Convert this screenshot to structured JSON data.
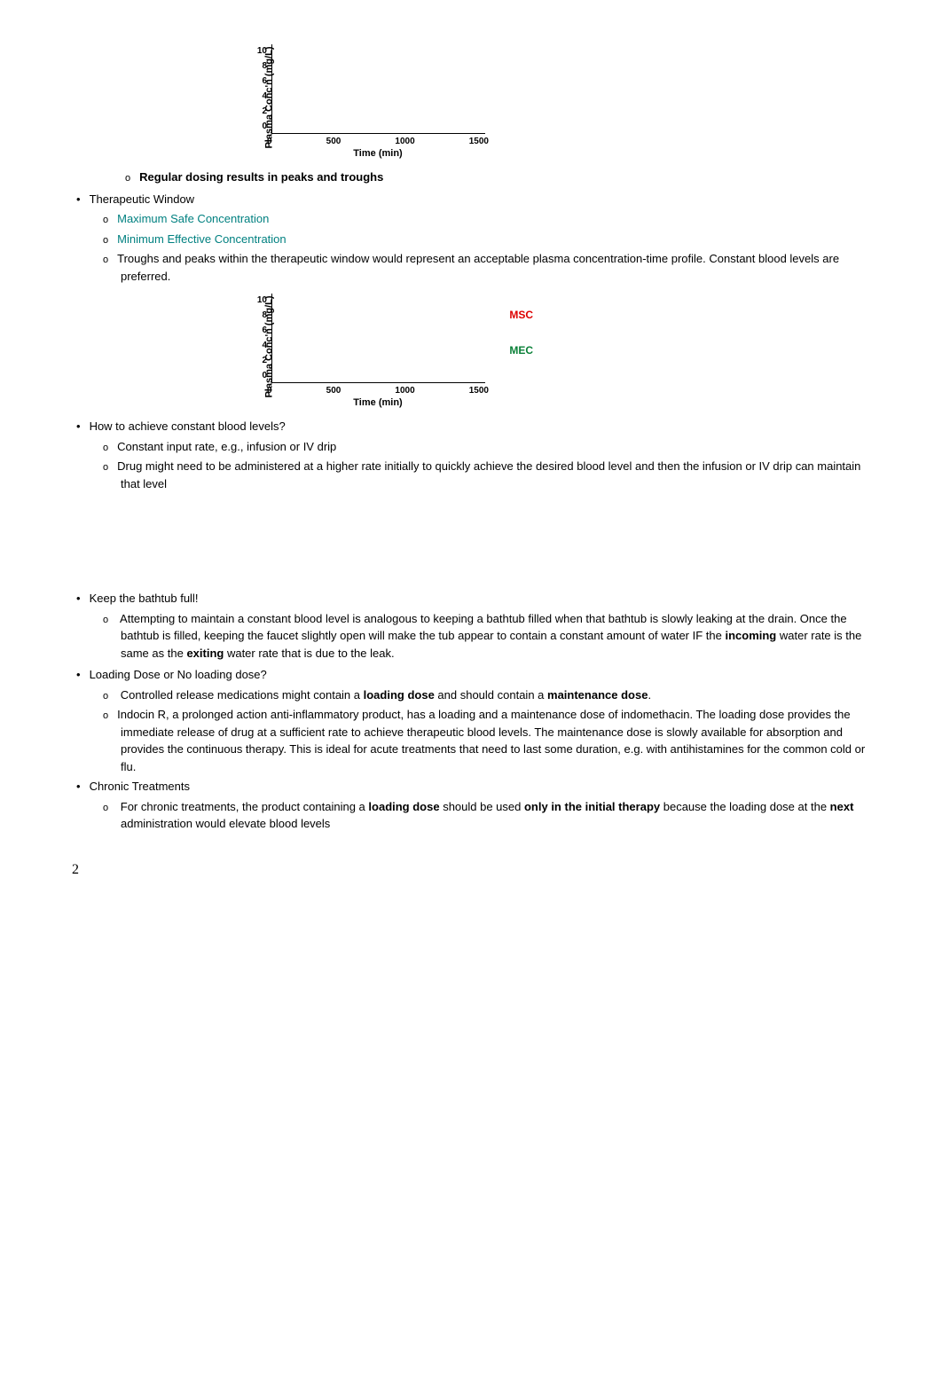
{
  "chart_data": [
    {
      "type": "line",
      "title": "",
      "xlabel": "Time (min)",
      "ylabel": "Plasma Conc'n (mg/L)",
      "x_ticks": [
        "0",
        "500",
        "1000",
        "1500"
      ],
      "y_ticks": [
        "10",
        "8",
        "6",
        "4",
        "2",
        "0"
      ],
      "xlim": [
        0,
        1500
      ],
      "ylim": [
        0,
        10
      ],
      "series": []
    },
    {
      "type": "line",
      "title": "",
      "xlabel": "Time (min)",
      "ylabel": "Plasma Conc'n (mg/L)",
      "x_ticks": [
        "0",
        "500",
        "1000",
        "1500"
      ],
      "y_ticks": [
        "10",
        "8",
        "6",
        "4",
        "2",
        "0"
      ],
      "xlim": [
        0,
        1500
      ],
      "ylim": [
        0,
        10
      ],
      "annotations": [
        {
          "label": "MSC",
          "color": "red"
        },
        {
          "label": "MEC",
          "color": "green"
        }
      ],
      "series": []
    }
  ],
  "section1": {
    "bullet_heading": "Regular dosing results in peaks and troughs"
  },
  "therapeutic": {
    "title": "Therapeutic Window",
    "items": [
      "Maximum Safe Concentration",
      "Minimum Effective Concentration",
      "Troughs and peaks within the therapeutic window would represent an acceptable plasma concentration-time profile. Constant blood levels are preferred."
    ]
  },
  "howto": {
    "title": "How to achieve constant blood levels?",
    "items": [
      "Constant input rate, e.g., infusion or IV drip",
      "Drug might need to be administered at a higher rate initially to quickly achieve the desired blood level and then the infusion or IV drip can maintain that level"
    ]
  },
  "bathtub": {
    "title": "Keep the bathtub full!",
    "text_pre": "Attempting to maintain a constant blood level is analogous to keeping a bathtub filled when that bathtub is slowly leaking at the drain.  Once the bathtub is filled, keeping the faucet slightly open will make the tub appear to contain a constant amount of water IF the ",
    "bold1": "incoming",
    "text_mid": " water rate is the same as the ",
    "bold2": "exiting",
    "text_end": " water rate that is due to the leak."
  },
  "loading": {
    "title": "Loading Dose or No loading dose?",
    "item1_pre": "Controlled release medications might contain a ",
    "item1_bold1": "loading dose",
    "item1_mid": " and should contain a ",
    "item1_bold2": "maintenance dose",
    "item1_end": ".",
    "item2": "Indocin R, a prolonged action anti-inflammatory product, has a loading and a maintenance dose of indomethacin.  The loading dose provides the immediate release of drug at a sufficient rate to achieve therapeutic blood levels.  The maintenance dose is slowly available for absorption and provides the continuous therapy.  This is ideal for acute treatments that need to last some duration, e.g. with antihistamines for the common cold or flu."
  },
  "chronic": {
    "title": "Chronic Treatments",
    "text_pre": "For chronic treatments, the product containing a ",
    "bold1": "loading dose",
    "text_mid1": " should be used ",
    "bold2": "only in the initial therapy",
    "text_mid2": " because the loading dose at the ",
    "bold3": "next",
    "text_end": " administration would elevate blood levels"
  },
  "page_number": "2"
}
